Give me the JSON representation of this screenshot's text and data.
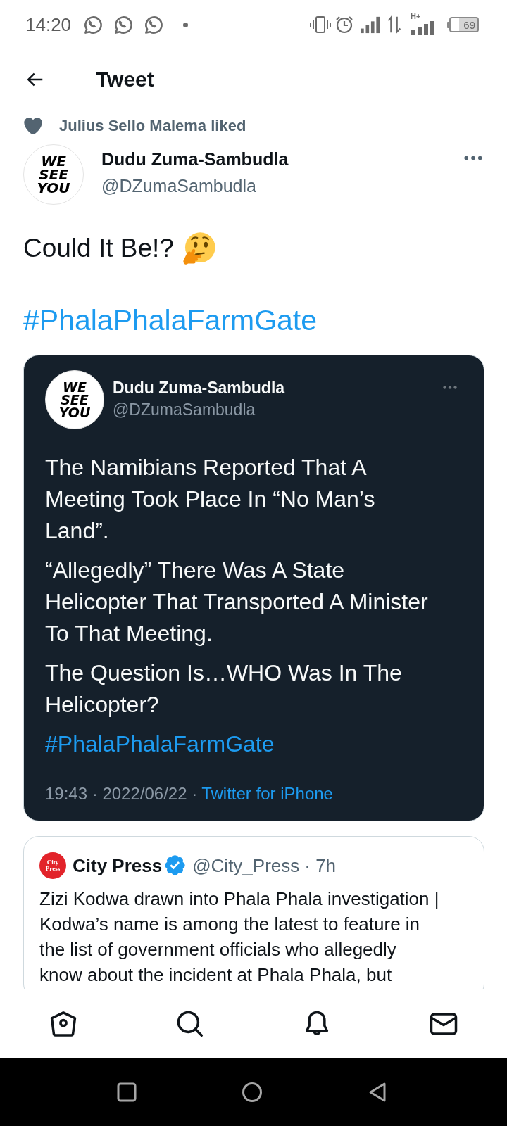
{
  "status_bar": {
    "time": "14:20",
    "network_type": "H+",
    "battery": "69"
  },
  "header": {
    "title": "Tweet"
  },
  "social_context": {
    "text": "Julius Sello Malema liked"
  },
  "tweet": {
    "author": {
      "name": "Dudu Zuma-Sambudla",
      "handle": "@DZumaSambudla",
      "avatar_text": "WE\nSEE\nYOU"
    },
    "text": "Could It Be!?",
    "hashtag": "#PhalaPhalaFarmGate",
    "screenshot": {
      "author": {
        "name": "Dudu Zuma-Sambudla",
        "handle": "@DZumaSambudla",
        "avatar_text": "WE\nSEE\nYOU"
      },
      "paragraphs": [
        "The Namibians Reported That A\nMeeting Took Place In “No Man’s\nLand”.",
        "“Allegedly” There Was A State\nHelicopter That Transported A Minister\nTo That Meeting.",
        "The Question Is…WHO Was In The\nHelicopter?"
      ],
      "hashtag": "#PhalaPhalaFarmGate",
      "timestamp": "19:43 · 2022/06/22 ·",
      "source": "Twitter for iPhone"
    },
    "quoted_tweet": {
      "logo_text": "City\nPress",
      "name": "City Press",
      "verified": true,
      "handle": "@City_Press",
      "time": "· 7h",
      "text": "Zizi Kodwa drawn into Phala Phala investigation |\nKodwa’s name is among the latest to feature in\nthe list of government officials who allegedly\nknow about the incident at Phala Phala, but"
    }
  }
}
